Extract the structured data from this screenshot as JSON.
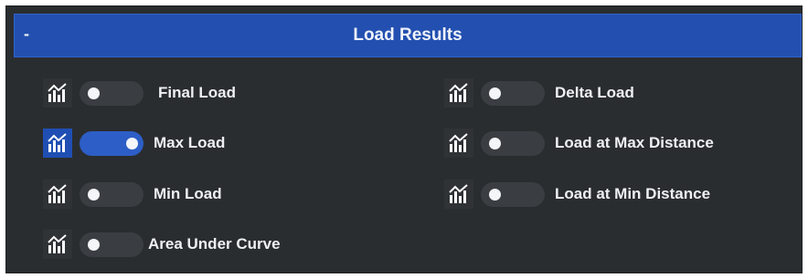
{
  "panel": {
    "collapse_symbol": "-",
    "title": "Load Results"
  },
  "left_column": [
    {
      "label": "Final Load",
      "enabled": false,
      "icon": "chart-icon"
    },
    {
      "label": "Max Load",
      "enabled": true,
      "icon": "chart-icon"
    },
    {
      "label": "Min Load",
      "enabled": false,
      "icon": "chart-icon"
    },
    {
      "label": "Area Under Curve",
      "enabled": false,
      "icon": "chart-icon"
    }
  ],
  "right_column": [
    {
      "label": "Delta Load",
      "enabled": false,
      "icon": "chart-icon"
    },
    {
      "label": "Load at Max Distance",
      "enabled": false,
      "icon": "chart-icon"
    },
    {
      "label": "Load at Min Distance",
      "enabled": false,
      "icon": "chart-icon"
    }
  ],
  "colors": {
    "header": "#2350b0",
    "panel_bg": "#2a2d30",
    "toggle_on": "#2d5ec7",
    "toggle_off": "#3a3e42"
  }
}
